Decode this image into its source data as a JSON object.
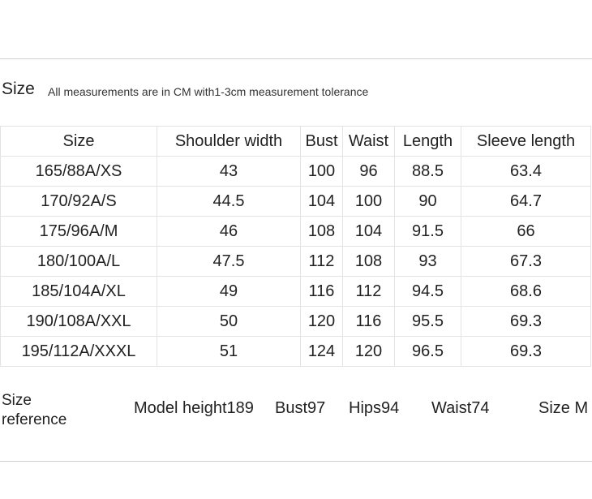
{
  "header": {
    "title": "Size",
    "note": "All measurements are in CM with1-3cm measurement tolerance"
  },
  "table": {
    "columns": [
      "Size",
      "Shoulder width",
      "Bust",
      "Waist",
      "Length",
      "Sleeve length"
    ],
    "rows": [
      [
        "165/88A/XS",
        "43",
        "100",
        "96",
        "88.5",
        "63.4"
      ],
      [
        "170/92A/S",
        "44.5",
        "104",
        "100",
        "90",
        "64.7"
      ],
      [
        "175/96A/M",
        "46",
        "108",
        "104",
        "91.5",
        "66"
      ],
      [
        "180/100A/L",
        "47.5",
        "112",
        "108",
        "93",
        "67.3"
      ],
      [
        "185/104A/XL",
        "49",
        "116",
        "112",
        "94.5",
        "68.6"
      ],
      [
        "190/108A/XXL",
        "50",
        "120",
        "116",
        "95.5",
        "69.3"
      ],
      [
        "195/112A/XXXL",
        "51",
        "124",
        "120",
        "96.5",
        "69.3"
      ]
    ]
  },
  "reference": {
    "label_line1": "Size",
    "label_line2": "reference",
    "model_height": "Model height189",
    "bust": "Bust97",
    "hips": "Hips94",
    "waist": "Waist74",
    "size": "Size M"
  }
}
